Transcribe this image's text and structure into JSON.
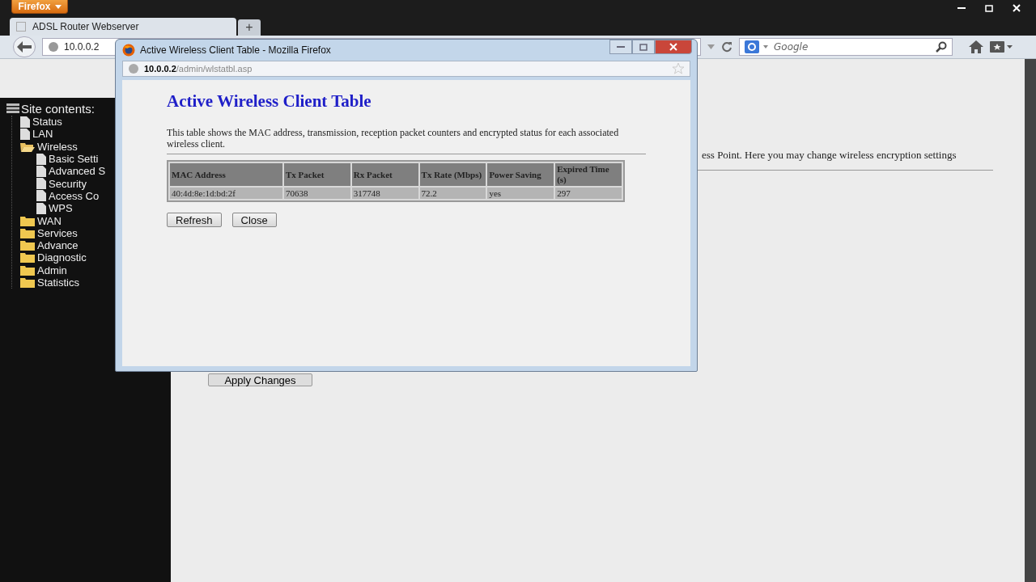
{
  "browser": {
    "menu_button": "Firefox",
    "tabs": [
      {
        "label": "ADSL Router Webserver",
        "selected": true
      }
    ],
    "new_tab": "+",
    "address": "10.0.0.2",
    "search": {
      "placeholder": "Google"
    }
  },
  "sidebar": {
    "title": "Site contents:",
    "items": [
      {
        "label": "Status",
        "kind": "page"
      },
      {
        "label": "LAN",
        "kind": "page"
      },
      {
        "label": "Wireless",
        "kind": "folder",
        "expanded": true,
        "children": [
          {
            "label": "Basic Setti",
            "kind": "page"
          },
          {
            "label": "Advanced S",
            "kind": "page"
          },
          {
            "label": "Security",
            "kind": "page"
          },
          {
            "label": "Access Co",
            "kind": "page"
          },
          {
            "label": "WPS",
            "kind": "page"
          }
        ]
      },
      {
        "label": "WAN",
        "kind": "folder",
        "expanded": false
      },
      {
        "label": "Services",
        "kind": "folder",
        "expanded": false
      },
      {
        "label": "Advance",
        "kind": "folder",
        "expanded": false
      },
      {
        "label": "Diagnostic",
        "kind": "folder",
        "expanded": false
      },
      {
        "label": "Admin",
        "kind": "folder",
        "expanded": false
      },
      {
        "label": "Statistics",
        "kind": "folder",
        "expanded": false
      }
    ]
  },
  "page": {
    "description": "ess Point. Here you may change wireless encryption settings",
    "button": "Apply Changes"
  },
  "popup": {
    "title": "Active Wireless Client Table - Mozilla Firefox",
    "url_host": "10.0.0.2",
    "url_path": "/admin/wlstatbl.asp",
    "heading": "Active Wireless Client Table",
    "description": "This table shows the MAC address, transmission, reception packet counters and encrypted status for each associated wireless client.",
    "table": {
      "columns": [
        "MAC Address",
        "Tx Packet",
        "Rx Packet",
        "Tx Rate (Mbps)",
        "Power Saving",
        "Expired Time (s)"
      ],
      "rows": [
        [
          "40:4d:8e:1d:bd:2f",
          "70638",
          "317748",
          "72.2",
          "yes",
          "297"
        ]
      ]
    },
    "buttons": [
      "Refresh",
      "Close"
    ]
  }
}
